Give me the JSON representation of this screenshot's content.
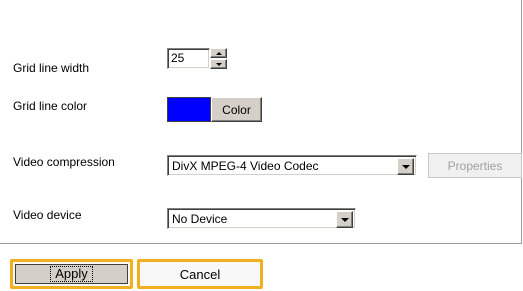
{
  "settings": {
    "grid_line_width_label": "Grid line width",
    "grid_line_width_value": "25",
    "grid_line_color_label": "Grid line color",
    "grid_line_color_value": "#0000ff",
    "color_button_label": "Color",
    "video_compression_label": "Video compression",
    "video_compression_value": "DivX MPEG-4 Video Codec",
    "properties_button_label": "Properties",
    "video_device_label": "Video device",
    "video_device_value": "No Device"
  },
  "footer": {
    "apply_label": "Apply",
    "cancel_label": "Cancel"
  },
  "colors": {
    "highlight_border": "#f0b020",
    "swatch": "#0000ff"
  }
}
